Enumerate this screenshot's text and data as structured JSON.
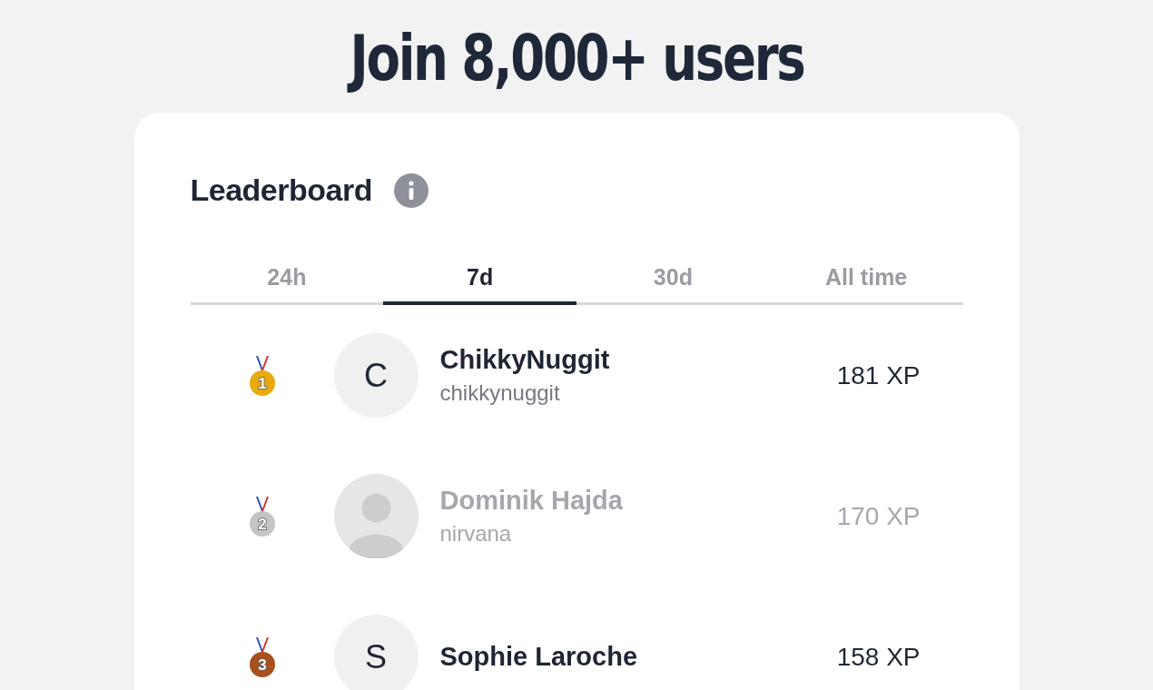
{
  "headline": "Join 8,000+ users",
  "card": {
    "title": "Leaderboard",
    "tabs": [
      {
        "label": "24h",
        "selected": false
      },
      {
        "label": "7d",
        "selected": true
      },
      {
        "label": "30d",
        "selected": false
      },
      {
        "label": "All time",
        "selected": false
      }
    ],
    "rows": [
      {
        "rank": "1",
        "color": "#e8a90c",
        "avatar": {
          "kind": "letter",
          "letter": "C"
        },
        "name": "ChikkyNuggit",
        "username": "chikkynuggit",
        "xp": "181 XP",
        "dimmed": false
      },
      {
        "rank": "2",
        "color": "#c4c4c4",
        "avatar": {
          "kind": "photo"
        },
        "name": "Dominik Hajda",
        "username": "nirvana",
        "xp": "170 XP",
        "dimmed": true
      },
      {
        "rank": "3",
        "color": "#a8511c",
        "avatar": {
          "kind": "letter",
          "letter": "S"
        },
        "name": "Sophie Laroche",
        "xp": "158 XP",
        "dimmed": false
      }
    ]
  }
}
